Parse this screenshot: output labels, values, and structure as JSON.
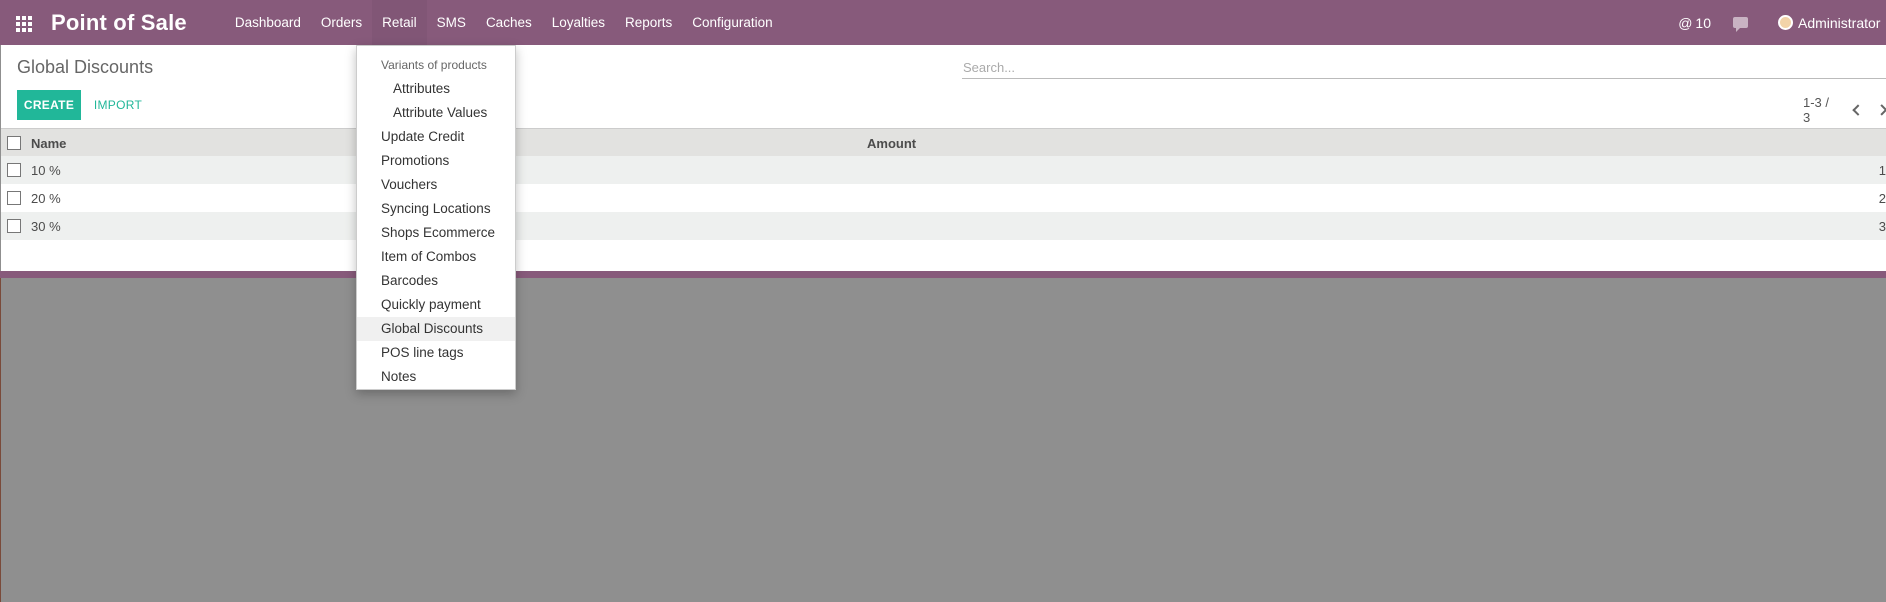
{
  "navbar": {
    "brand": "Point of Sale",
    "menu": [
      "Dashboard",
      "Orders",
      "Retail",
      "SMS",
      "Caches",
      "Loyalties",
      "Reports",
      "Configuration"
    ],
    "activity_count": "10",
    "user": "Administrator",
    "color": "#875a7b"
  },
  "page": {
    "title": "Global Discounts",
    "search_placeholder": "Search...",
    "create_label": "CREATE",
    "import_label": "IMPORT",
    "pager": "1-3 / 3",
    "accent": "#21b799"
  },
  "table": {
    "columns": [
      "Name",
      "Amount"
    ],
    "rows": [
      {
        "name": "10 %",
        "amount": "1"
      },
      {
        "name": "20 %",
        "amount": "2"
      },
      {
        "name": "30 %",
        "amount": "3"
      }
    ]
  },
  "dropdown": {
    "header": "Variants of products",
    "sub_items": [
      "Attributes",
      "Attribute Values"
    ],
    "items": [
      "Update Credit",
      "Promotions",
      "Vouchers",
      "Syncing Locations",
      "Shops Ecommerce",
      "Item of Combos",
      "Barcodes",
      "Quickly payment",
      "Global Discounts",
      "POS line tags",
      "Notes"
    ],
    "active": "Global Discounts"
  }
}
